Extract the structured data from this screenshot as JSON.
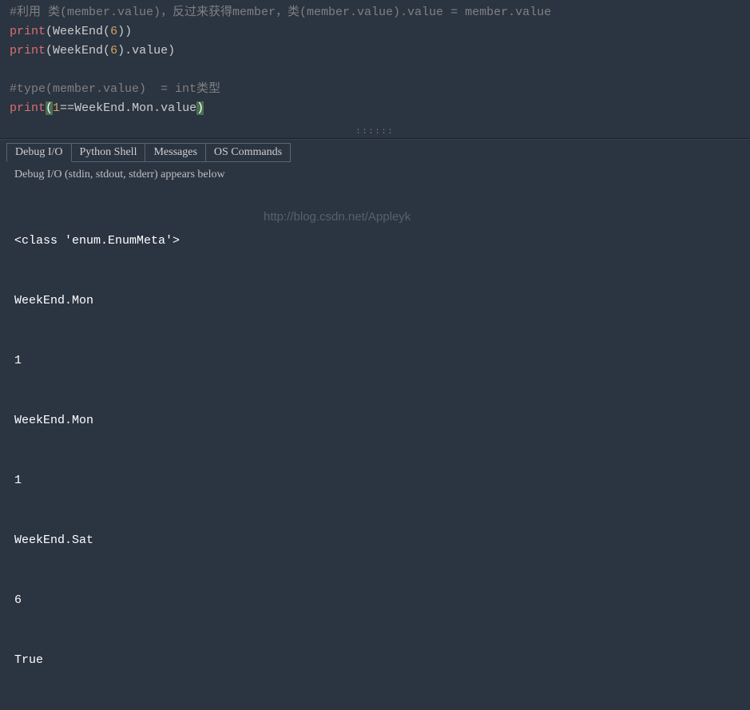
{
  "editor": {
    "line1_comment": "#利用 类(member.value)，反过来获得member，类(member.value).value = member.value",
    "line2_print": "print",
    "line2_lparen": "(",
    "line2_func": "WeekEnd",
    "line2_iparen_l": "(",
    "line2_num": "6",
    "line2_iparen_r": ")",
    "line2_rparen": ")",
    "line3_print": "print",
    "line3_lparen": "(",
    "line3_func": "WeekEnd",
    "line3_iparen_l": "(",
    "line3_num": "6",
    "line3_iparen_r": ")",
    "line3_dot": ".",
    "line3_attr": "value",
    "line3_rparen": ")",
    "line5_comment": "#type(member.value)  = int类型",
    "line6_print": "print",
    "line6_lparen": "(",
    "line6_num": "1",
    "line6_op": "==",
    "line6_id": "WeekEnd",
    "line6_dot1": ".",
    "line6_attr1": "Mon",
    "line6_dot2": ".",
    "line6_attr2": "value",
    "line6_rparen": ")"
  },
  "tabs": {
    "debug_io": "Debug I/O",
    "python_shell": "Python Shell",
    "messages": "Messages",
    "os_commands": "OS Commands"
  },
  "panel_label": "Debug I/O (stdin, stdout, stderr) appears below",
  "watermark": "http://blog.csdn.net/Appleyk",
  "output_lines": [
    "<class 'enum.EnumMeta'>",
    "WeekEnd.Mon",
    "1",
    "WeekEnd.Mon",
    "1",
    "WeekEnd.Sat",
    "6",
    "True"
  ]
}
